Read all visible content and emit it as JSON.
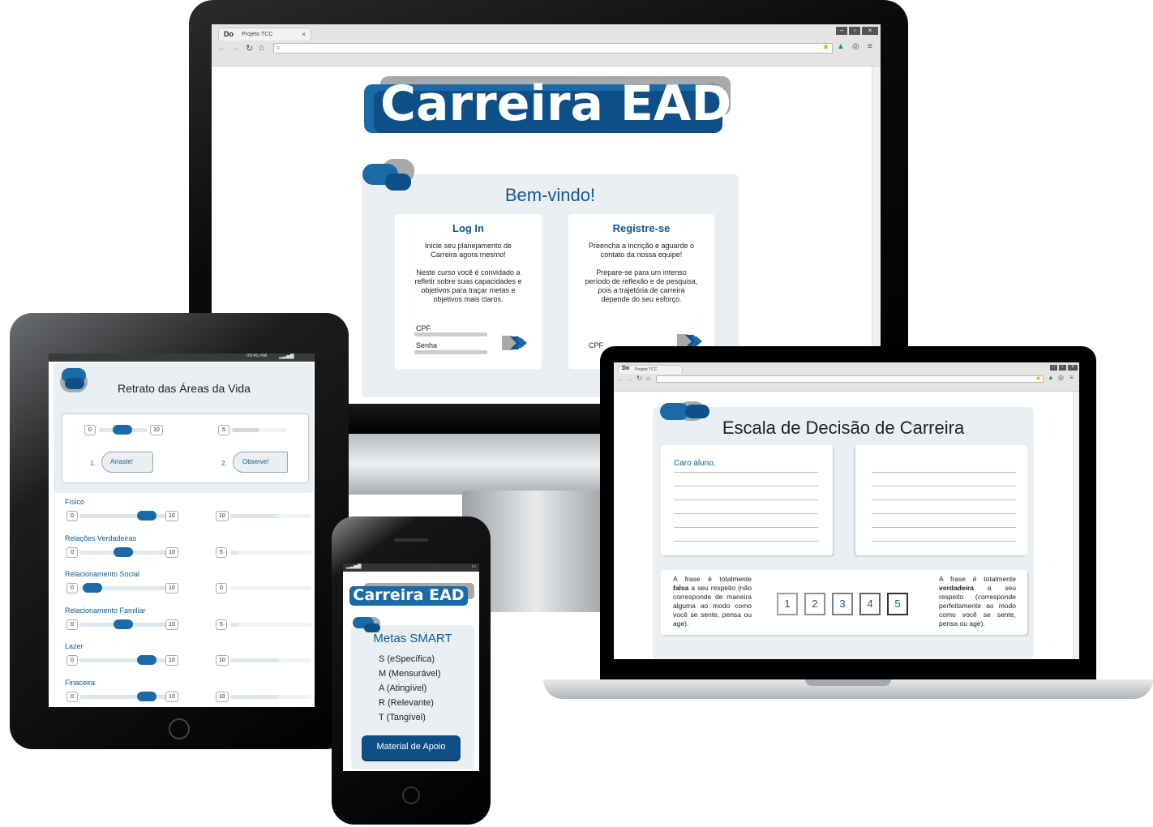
{
  "browser": {
    "tab_title": "Projeto TCC",
    "tab_logo": "Do"
  },
  "monitor": {
    "logo_title": "Carreira EAD",
    "welcome": "Bem-vindo!",
    "login": {
      "heading": "Log In",
      "text1": "Inicie seu planejamento de Carreira agora mesmo!",
      "text2": "Neste curso você é convidado a refletir sobre suas capacidades e objetivos para traçar metas e objetivos mais claros.",
      "cpf_label": "CPF",
      "senha_label": "Senha"
    },
    "register": {
      "heading": "Registre-se",
      "text1": "Preencha a incrição e aguarde o contato da nossa equipe!",
      "text2": "Prepare-se para um intenso período de reflexão e de pesquisa, pois a trajetória de carreira depende do seu esforço.",
      "cpf_label": "CPF"
    }
  },
  "tablet": {
    "status_time": "09:45 AM",
    "title": "Retrato das Áreas da Vida",
    "demo": {
      "min": "0",
      "max": "10",
      "value": "5",
      "step1_num": "1.",
      "step1_label": "Arraste!",
      "step2_num": "2.",
      "step2_label": "Observe!"
    },
    "areas": [
      {
        "label": "Físico",
        "min": "0",
        "max": "10",
        "value": "10",
        "level": 0.85
      },
      {
        "label": "Relações Verdadeiras",
        "min": "0",
        "max": "10",
        "value": "5",
        "level": 0.5
      },
      {
        "label": "Relacionamento Social",
        "min": "0",
        "max": "10",
        "value": "0",
        "level": 0.05
      },
      {
        "label": "Relacionamento Familiar",
        "min": "0",
        "max": "10",
        "value": "5",
        "level": 0.5
      },
      {
        "label": "Lazer",
        "min": "0",
        "max": "10",
        "value": "10",
        "level": 0.85
      },
      {
        "label": "Finaceira",
        "min": "0",
        "max": "10",
        "value": "10",
        "level": 0.85
      }
    ]
  },
  "laptop": {
    "title": "Escala de Decisão de Carreira",
    "greeting": "Caro aluno,",
    "left_scale": {
      "prefix": "A frase é totalmente ",
      "bold": "falsa",
      "suffix": " a seu respeito (não corresponde de maneira alguma ao modo como você se sente, pensa ou age)."
    },
    "right_scale": {
      "prefix": "A frase é totalmente ",
      "bold": "verdadeira",
      "suffix": " a seu respeito (corresponde perfeitamente ao modo como você se sente, pensa ou age)."
    },
    "scale": [
      "1",
      "2",
      "3",
      "4",
      "5"
    ]
  },
  "phone": {
    "logo_title": "Carreira EAD",
    "section_title": "Metas SMART",
    "items": [
      "S (eSpecífica)",
      "M (Mensurável)",
      "A (Atingível)",
      "R (Relevante)",
      "T (Tangível)"
    ],
    "button": "Material de Apoio"
  },
  "colors": {
    "brand_blue": "#0d5a95",
    "dark_blue": "#1b4f7a",
    "panel_bg": "#e9eff3",
    "logo_gray": "#a7a9ab"
  }
}
